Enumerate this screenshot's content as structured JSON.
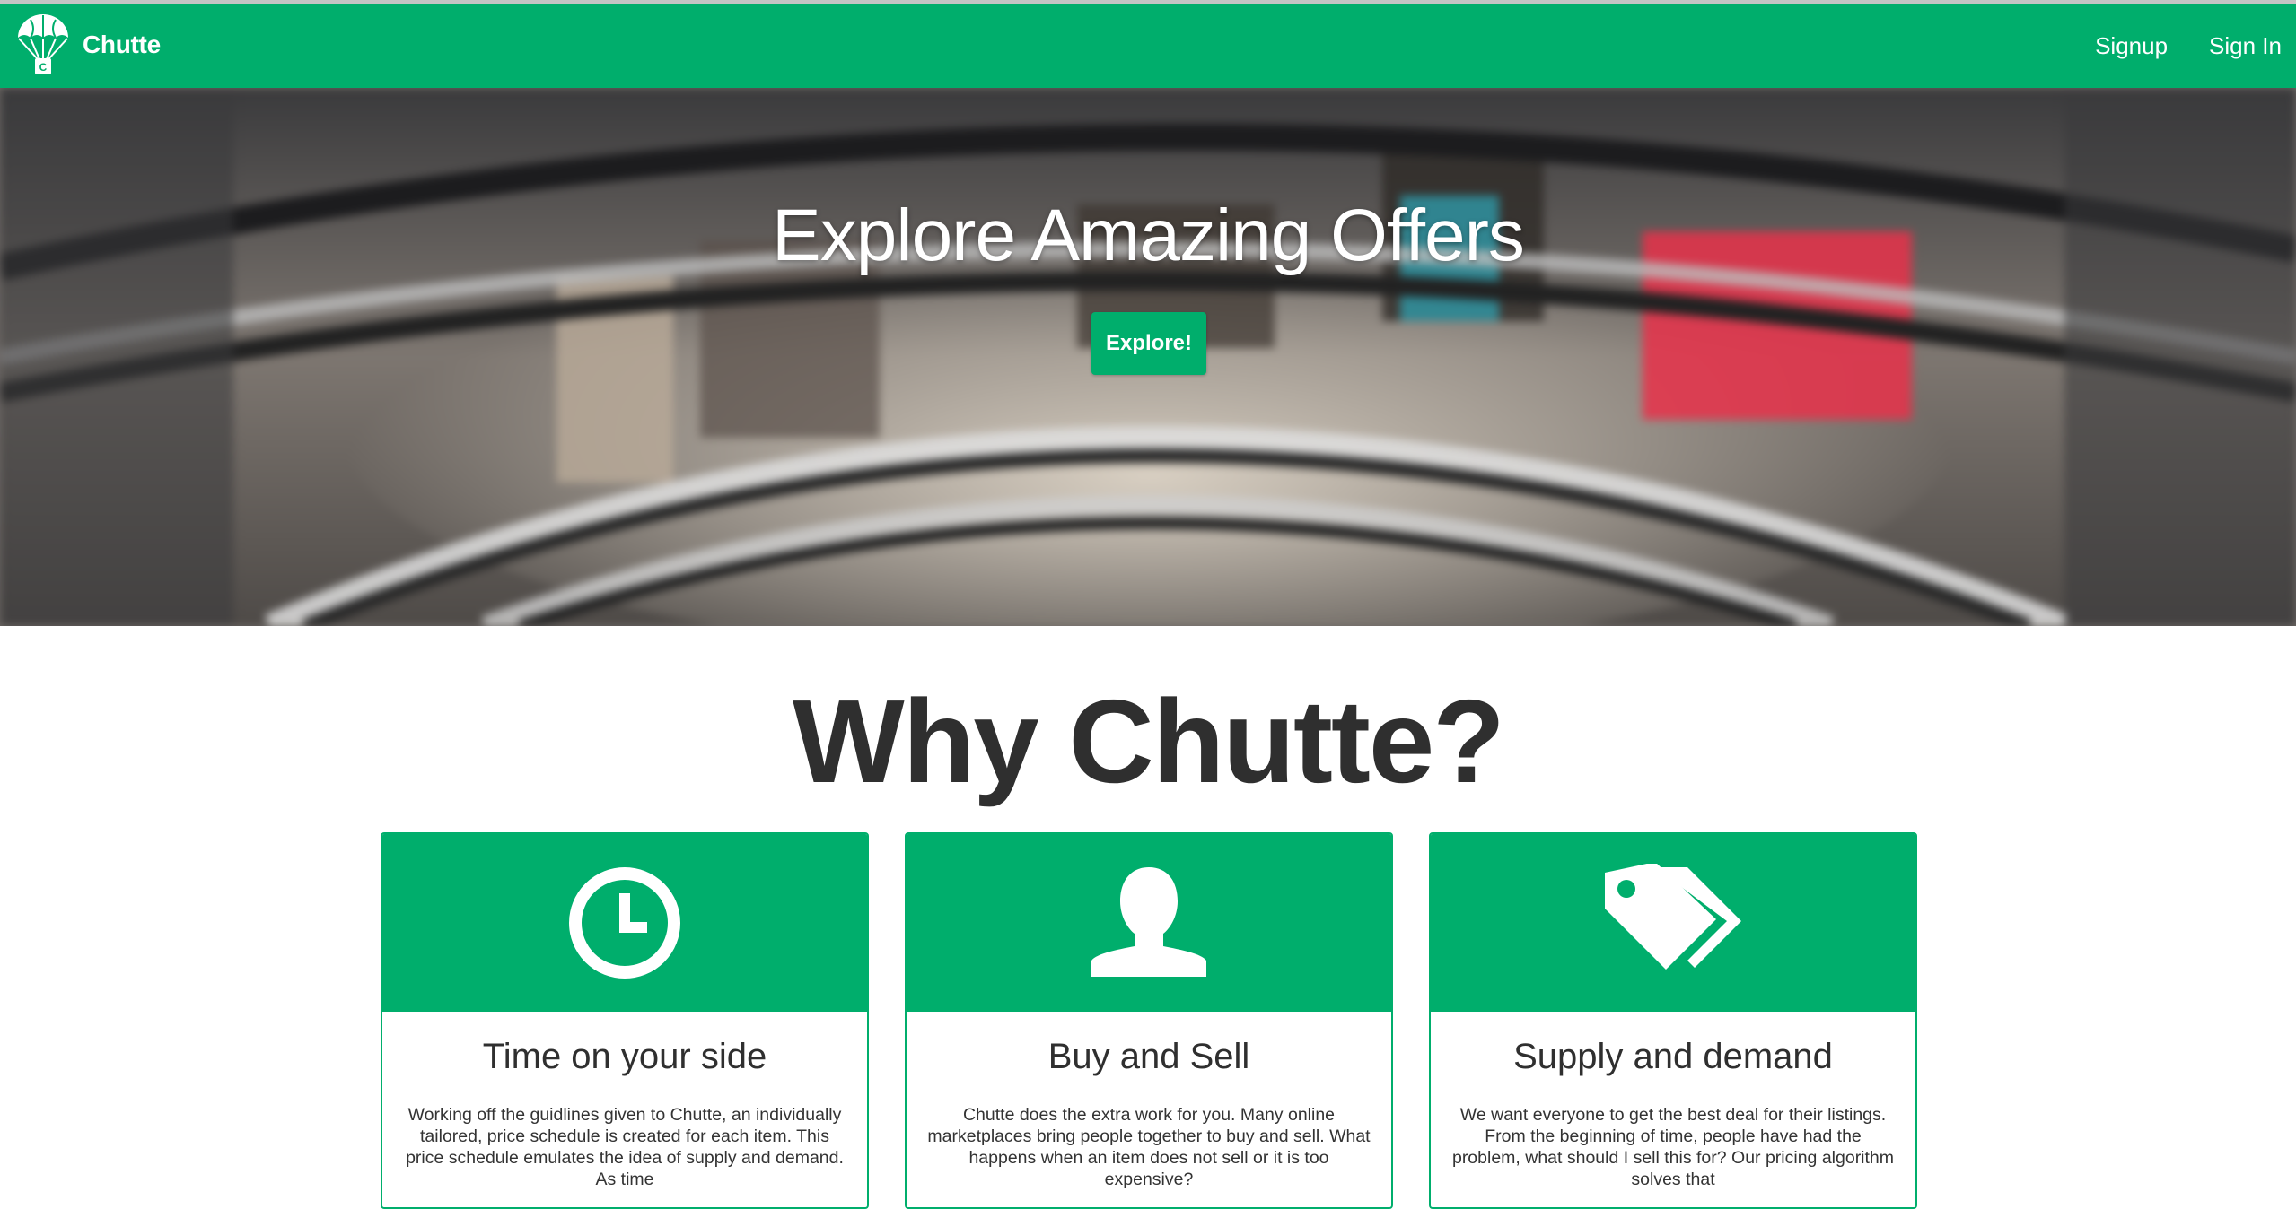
{
  "navbar": {
    "brand": "Chutte",
    "logo_icon": "parachute-icon",
    "links": {
      "signup": "Signup",
      "signin": "Sign In"
    },
    "color": "#00ae6c"
  },
  "hero": {
    "title": "Explore Amazing Offers",
    "button": "Explore!",
    "background": "blurred shopping mall interior photo"
  },
  "why": {
    "title": "Why Chutte?",
    "cards": [
      {
        "icon": "clock-icon",
        "title": "Time on your side",
        "text": "Working off the guidlines given to Chutte, an individually tailored, price schedule is created for each item. This price schedule emulates the idea of supply and demand. As time"
      },
      {
        "icon": "user-icon",
        "title": "Buy and Sell",
        "text": "Chutte does the extra work for you. Many online marketplaces bring people together to buy and sell. What happens when an item does not sell or it is too expensive?"
      },
      {
        "icon": "tags-icon",
        "title": "Supply and demand",
        "text": "We want everyone to get the best deal for their listings. From the beginning of time, people have had the problem, what should I sell this for? Our pricing algorithm solves that"
      }
    ]
  }
}
